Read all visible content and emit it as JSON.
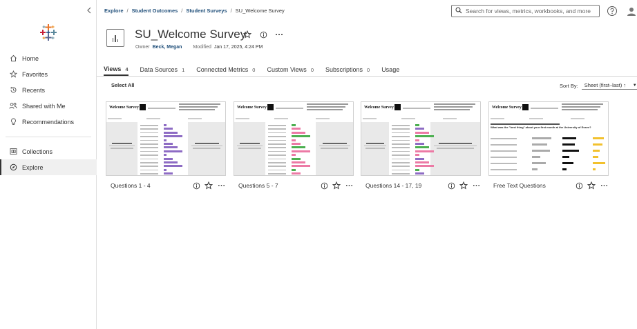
{
  "breadcrumb": [
    "Explore",
    "Student Outcomes",
    "Student Surveys"
  ],
  "breadcrumb_current": "SU_Welcome Survey",
  "search": {
    "placeholder": "Search for views, metrics, workbooks, and more"
  },
  "sidebar": {
    "items": [
      {
        "label": "Home",
        "icon": "home-icon"
      },
      {
        "label": "Favorites",
        "icon": "star-icon"
      },
      {
        "label": "Recents",
        "icon": "history-icon"
      },
      {
        "label": "Shared with Me",
        "icon": "shared-icon"
      },
      {
        "label": "Recommendations",
        "icon": "lightbulb-icon"
      }
    ],
    "items2": [
      {
        "label": "Collections",
        "icon": "collections-icon"
      },
      {
        "label": "Explore",
        "icon": "explore-icon",
        "active": true
      }
    ]
  },
  "workbook": {
    "title": "SU_Welcome Survey",
    "owner_label": "Owner",
    "owner": "Beck, Megan",
    "modified_label": "Modified",
    "modified": "Jan 17, 2025, 4:24 PM"
  },
  "tabs": [
    {
      "label": "Views",
      "count": "4",
      "active": true
    },
    {
      "label": "Data Sources",
      "count": "1"
    },
    {
      "label": "Connected Metrics",
      "count": "0"
    },
    {
      "label": "Custom Views",
      "count": "0"
    },
    {
      "label": "Subscriptions",
      "count": "0"
    },
    {
      "label": "Usage",
      "count": ""
    }
  ],
  "toolbar": {
    "select_all": "Select All",
    "sort_label": "Sort By:",
    "sort_value": "Sheet (first–last) ↑"
  },
  "views": [
    {
      "name": "Questions 1 - 4"
    },
    {
      "name": "Questions 5 - 7"
    },
    {
      "name": "Questions 14 - 17, 19"
    },
    {
      "name": "Free Text Questions"
    }
  ],
  "thumbnail": {
    "dashboard_title": "Welcome Survey",
    "free_text_question": "What was the \"best thing\" about your first month at the University of Essex?"
  },
  "colors": {
    "link": "#1f4e79",
    "purple_bar": "#8e6cc4",
    "pink_bar": "#ec7aa5",
    "green_bar": "#4caf50",
    "yellow_bar": "#f2c12e"
  }
}
